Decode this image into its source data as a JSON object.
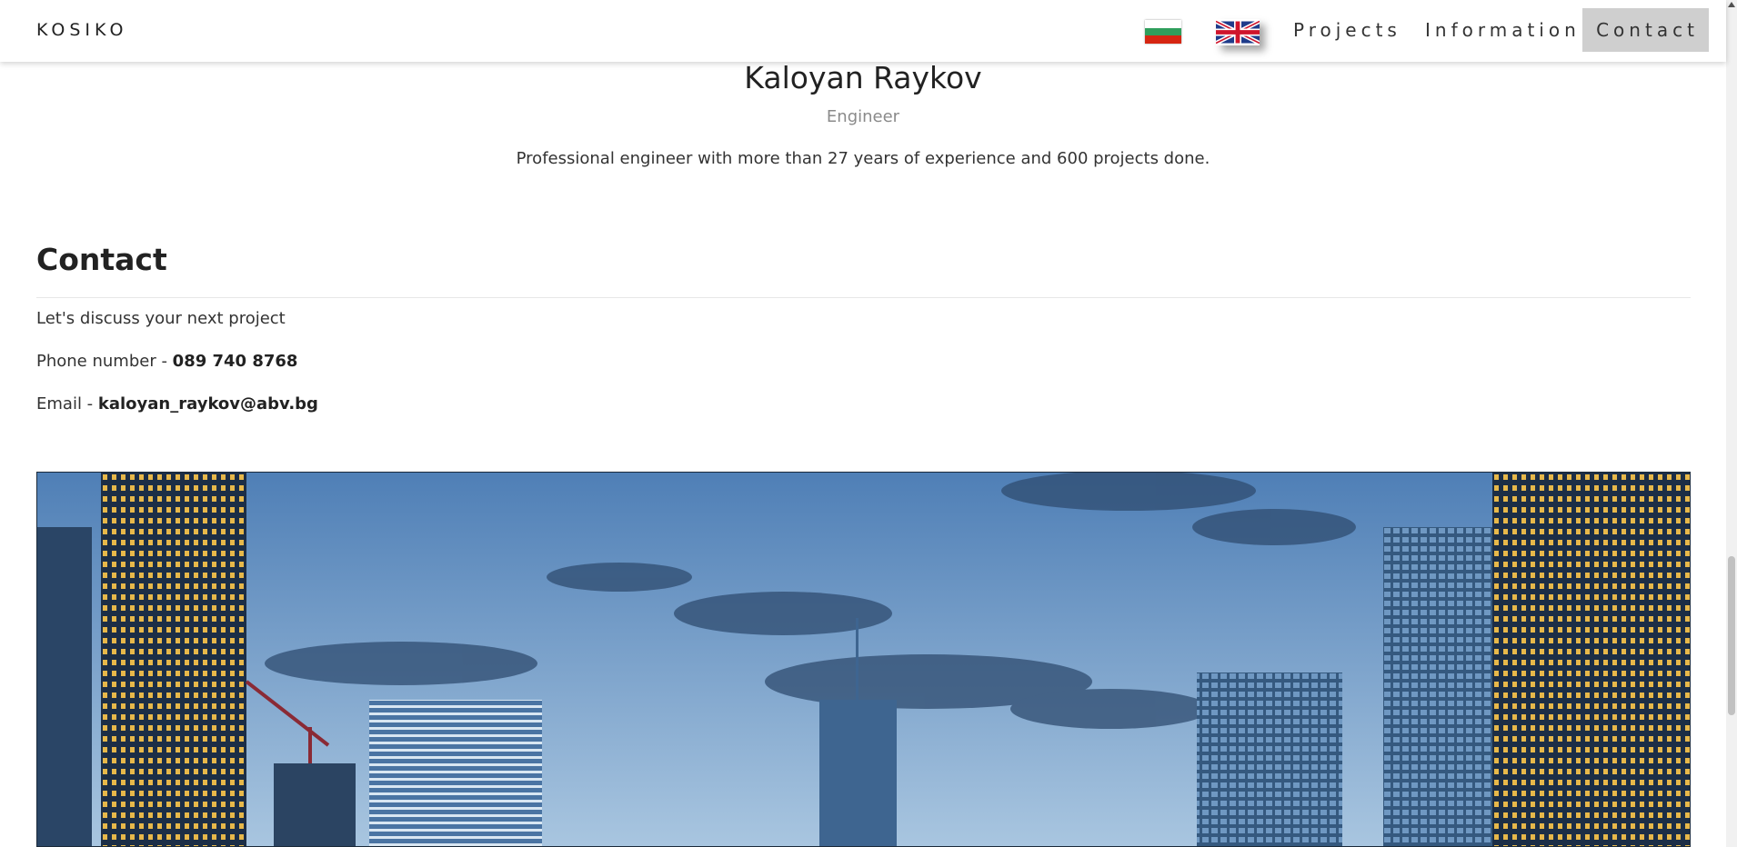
{
  "brand": "KOSIKO",
  "nav": {
    "flags": [
      "bulgarian-flag",
      "uk-flag"
    ],
    "projects": "Projects",
    "information": "Information",
    "contact": "Contact"
  },
  "profile": {
    "name": "Kaloyan Raykov",
    "role": "Engineer",
    "description": "Professional engineer with more than 27 years of experience and 600 projects done."
  },
  "contact": {
    "title": "Contact",
    "tagline": "Let's discuss your next project",
    "phone_label": "Phone number - ",
    "phone_value": "089 740 8768",
    "email_label": "Email - ",
    "email_value": "kaloyan_raykov@abv.bg"
  },
  "colors": {
    "nav_active_bg": "#cfcfcf",
    "muted_text": "#8a8a8a",
    "sky_top": "#4f7fb6",
    "sky_bottom": "#a9c6e0"
  }
}
